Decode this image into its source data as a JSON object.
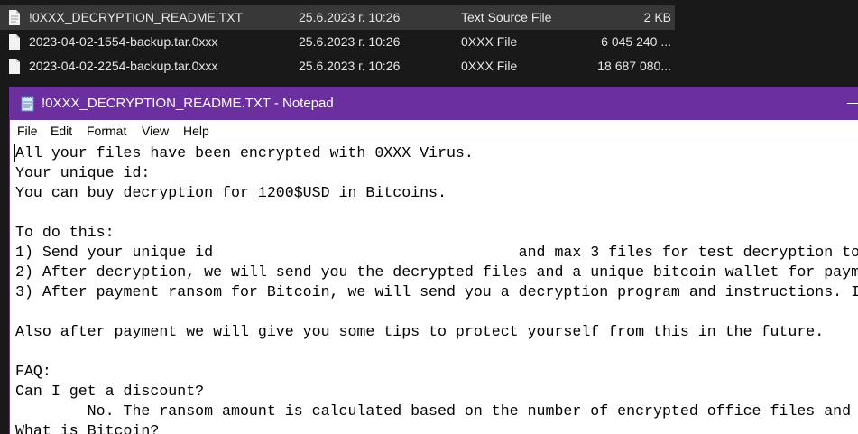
{
  "files": [
    {
      "name": "!0XXX_DECRYPTION_README.TXT",
      "date": "25.6.2023 г. 10:26",
      "type": "Text Source File",
      "size": "2 KB",
      "selected": true
    },
    {
      "name": "2023-04-02-1554-backup.tar.0xxx",
      "date": "25.6.2023 г. 10:26",
      "type": "0XXX File",
      "size": "6 045 240 ...",
      "selected": false
    },
    {
      "name": "2023-04-02-2254-backup.tar.0xxx",
      "date": "25.6.2023 г. 10:26",
      "type": "0XXX File",
      "size": "18 687 080...",
      "selected": false
    }
  ],
  "notepad": {
    "title": "!0XXX_DECRYPTION_README.TXT - Notepad",
    "menu": [
      "File",
      "Edit",
      "Format",
      "View",
      "Help"
    ],
    "lines": [
      "All your files have been encrypted with 0XXX Virus.",
      "Your unique id:",
      "You can buy decryption for 1200$USD in Bitcoins.",
      "",
      "To do this:",
      "1) Send your unique id                                  and max 3 files for test decryption to",
      "2) After decryption, we will send you the decrypted files and a unique bitcoin wallet for paym",
      "3) After payment ransom for Bitcoin, we will send you a decryption program and instructions. I",
      "",
      "Also after payment we will give you some tips to protect yourself from this in the future.",
      "",
      "FAQ:",
      "Can I get a discount?",
      "        No. The ransom amount is calculated based on the number of encrypted office files and",
      "What is Bitcoin?"
    ]
  }
}
